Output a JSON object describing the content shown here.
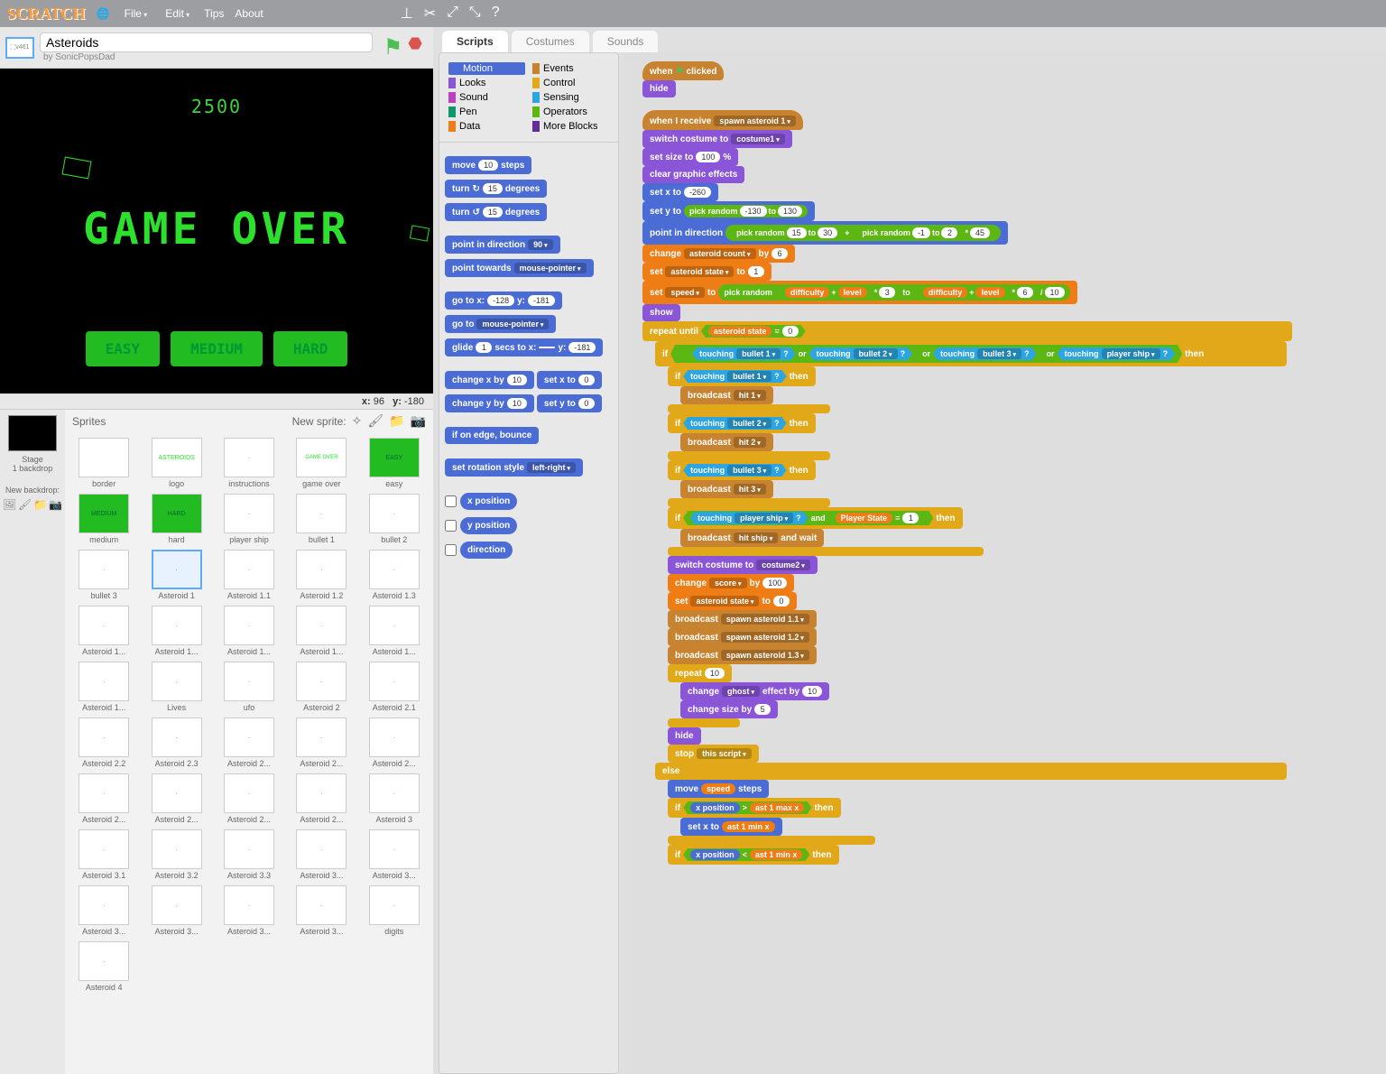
{
  "menu": {
    "logo": "SCRATCH",
    "file": "File",
    "edit": "Edit",
    "tips": "Tips",
    "about": "About"
  },
  "project": {
    "title": "Asteroids",
    "author": "by SonicPopsDad",
    "version": "v461"
  },
  "stage_view": {
    "score": "2500",
    "gameover": "GAME OVER",
    "easy": "EASY",
    "medium": "MEDIUM",
    "hard": "HARD"
  },
  "coords": {
    "x_label": "x:",
    "x": "96",
    "y_label": "y:",
    "y": "-180"
  },
  "stagecol": {
    "stage_label": "Stage",
    "backdrop_count": "1 backdrop",
    "new_backdrop": "New backdrop:"
  },
  "sprites_header": {
    "title": "Sprites",
    "new_sprite": "New sprite:"
  },
  "sprites": [
    "border",
    "logo",
    "instructions",
    "game over",
    "easy",
    "medium",
    "hard",
    "player ship",
    "bullet 1",
    "bullet 2",
    "bullet 3",
    "Asteroid 1",
    "Asteroid 1.1",
    "Asteroid 1.2",
    "Asteroid 1.3",
    "Asteroid 1...",
    "Asteroid 1...",
    "Asteroid 1...",
    "Asteroid 1...",
    "Asteroid 1...",
    "Asteroid 1...",
    "Lives",
    "ufo",
    "Asteroid 2",
    "Asteroid 2.1",
    "Asteroid 2.2",
    "Asteroid 2.3",
    "Asteroid 2...",
    "Asteroid 2...",
    "Asteroid 2...",
    "Asteroid 2...",
    "Asteroid 2...",
    "Asteroid 2...",
    "Asteroid 2...",
    "Asteroid 3",
    "Asteroid 3.1",
    "Asteroid 3.2",
    "Asteroid 3.3",
    "Asteroid 3...",
    "Asteroid 3...",
    "Asteroid 3...",
    "Asteroid 3...",
    "Asteroid 3...",
    "Asteroid 3...",
    "digits",
    "Asteroid 4"
  ],
  "selected_sprite": "Asteroid 1",
  "tabs": {
    "scripts": "Scripts",
    "costumes": "Costumes",
    "sounds": "Sounds"
  },
  "categories": {
    "motion": "Motion",
    "events": "Events",
    "looks": "Looks",
    "control": "Control",
    "sound": "Sound",
    "sensing": "Sensing",
    "pen": "Pen",
    "operators": "Operators",
    "data": "Data",
    "moreblocks": "More Blocks"
  },
  "cat_colors": {
    "motion": "#4a6cd4",
    "events": "#c88330",
    "looks": "#8a55d7",
    "control": "#e1a91a",
    "sound": "#bb42c3",
    "sensing": "#2ca5e2",
    "pen": "#0e9a6c",
    "operators": "#5cb712",
    "data": "#ee7d16",
    "moreblocks": "#632d99"
  },
  "palette": {
    "move": "move",
    "steps": "steps",
    "turn": "turn",
    "degrees": "degrees",
    "point_dir": "point in direction",
    "point_towards": "point towards",
    "goto_xy": "go to x:",
    "y": "y:",
    "goto": "go to",
    "glide": "glide",
    "secs_to_x": "secs to x:",
    "change_x": "change x by",
    "set_x": "set x to",
    "change_y": "change y by",
    "set_y": "set y to",
    "edge_bounce": "if on edge, bounce",
    "rot_style": "set rotation style",
    "xpos": "x position",
    "ypos": "y position",
    "dir": "direction",
    "vals": {
      "move10": "10",
      "turn15": "15",
      "dir90": "90",
      "mouse": "mouse-pointer",
      "gox": "-128",
      "goy": "-181",
      "glide1": "1",
      "chx": "10",
      "sx0": "0",
      "chy": "10",
      "sy0": "0",
      "lr": "left-right"
    }
  },
  "script": {
    "when_clicked": "when",
    "clicked": "clicked",
    "hide": "hide",
    "when_receive": "when I receive",
    "spawn_asteroid1": "spawn asteroid 1",
    "switch_costume": "switch costume to",
    "costume1": "costume1",
    "costume2": "costume2",
    "set_size": "set size to",
    "size100": "100",
    "pct": "%",
    "clear_gfx": "clear graphic effects",
    "set_x_to": "set x to",
    "neg260": "-260",
    "set_y_to": "set y to",
    "pick_random": "pick random",
    "neg130": "-130",
    "to": "to",
    "p130": "130",
    "point_in_dir": "point in direction",
    "p15": "15",
    "p30": "30",
    "plus": "+",
    "neg1": "-1",
    "p2": "2",
    "times": "*",
    "p45": "45",
    "change": "change",
    "asteroid_count": "asteroid count",
    "by": "by",
    "p6": "6",
    "set": "set",
    "asteroid_state": "asteroid state",
    "p1": "1",
    "p0": "0",
    "speed": "speed",
    "difficulty": "difficulty",
    "level": "level",
    "p3": "3",
    "slash": "/",
    "p10": "10",
    "show": "show",
    "repeat_until": "repeat until",
    "equals": "=",
    "if": "if",
    "then": "then",
    "else": "else",
    "touching": "touching",
    "bullet1": "bullet 1",
    "bullet2": "bullet 2",
    "bullet3": "bullet 3",
    "player_ship": "player ship",
    "q": "?",
    "or": "or",
    "broadcast": "broadcast",
    "hit1": "hit 1",
    "hit2": "hit 2",
    "hit3": "hit 3",
    "hit_ship": "hit ship",
    "and_wait": "and wait",
    "player_state": "Player State",
    "and": "and",
    "score": "score",
    "p100": "100",
    "spawn11": "spawn asteroid 1.1",
    "spawn12": "spawn asteroid 1.2",
    "spawn13": "spawn asteroid 1.3",
    "repeat": "repeat",
    "ghost": "ghost",
    "effect_by": "effect by",
    "size_by": "change size by",
    "p5": "5",
    "stop": "stop",
    "this_script": "this script",
    "move": "move",
    "steps": "steps",
    "xpos": "x position",
    "gt": ">",
    "lt": "<",
    "ast1maxx": "ast 1 max x",
    "ast1minx": "ast 1 min x"
  }
}
